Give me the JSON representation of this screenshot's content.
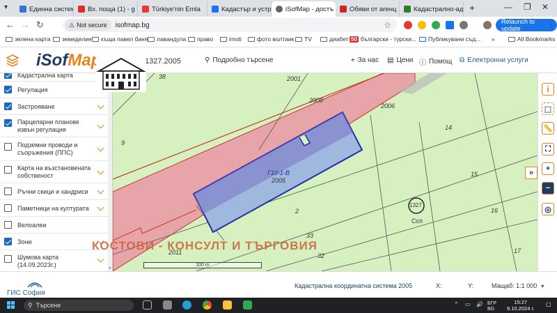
{
  "browser": {
    "tabs": [
      {
        "title": "Единна система"
      },
      {
        "title": "Вх. поща (1) - g"
      },
      {
        "title": "Türkiye'nin Emla"
      },
      {
        "title": "Кадастър и устр"
      },
      {
        "title": "iSofMap - достъ"
      },
      {
        "title": "Обяви от агенц"
      },
      {
        "title": "Кадастрално-ад"
      }
    ],
    "new_tab": "+",
    "address": {
      "security": "Not secure",
      "url": "isofmap.bg"
    },
    "relaunch_label": "Relaunch to update",
    "bookmarks": [
      {
        "label": "зелена карта"
      },
      {
        "label": "земеделие"
      },
      {
        "label": "къща павел баня"
      },
      {
        "label": "лавандула"
      },
      {
        "label": "право"
      },
      {
        "label": "imoti"
      },
      {
        "label": "фото волтаик"
      },
      {
        "label": "TV"
      },
      {
        "label": "диабет"
      },
      {
        "label": "български - турски..."
      },
      {
        "label": "Публикувани съд..."
      }
    ],
    "bookmark_badge": "50",
    "more_bookmarks": "»",
    "all_bookmarks": "All Bookmarks"
  },
  "app": {
    "logo_main": "iSof",
    "logo_accent": "Map",
    "search_value": "1327.2005",
    "advanced_search": "Подробно търсене",
    "nav": {
      "about": "За нас",
      "prices": "Цени",
      "help": "Помощ",
      "eservices": "Електронни услуги"
    }
  },
  "sidebar": {
    "items": [
      {
        "label": "Кадастрална карта",
        "checked": true
      },
      {
        "label": "Регулация",
        "checked": true
      },
      {
        "label": "Застрояване",
        "checked": true
      },
      {
        "label": "Парцеларни планове извън регулация",
        "checked": true
      },
      {
        "label": "Подземни проводи и съоръжения (ППС)",
        "checked": false
      },
      {
        "label": "Карта на възстановената собственост",
        "checked": false
      },
      {
        "label": "Ръчни скици и хандриси",
        "checked": false
      },
      {
        "label": "Паметници на културата",
        "checked": false
      },
      {
        "label": "Велоалеи",
        "checked": false
      },
      {
        "label": "Зони",
        "checked": true
      },
      {
        "label": "Шумова карта (14.09.2023г.)",
        "checked": false
      }
    ]
  },
  "map": {
    "labels": {
      "l38": "38",
      "l2001": "2001",
      "l2008": "2008",
      "l2006": "2006",
      "l14": "14",
      "l9": "9",
      "l10": "Г10-1-В",
      "l2005": "2005",
      "l15": "15",
      "l2": "2",
      "l16": "16",
      "l33": "33",
      "l32": "32",
      "l2011": "2011",
      "l17": "17",
      "circle": "1327",
      "csp": "Ссп"
    },
    "watermark": "КОСТОВИ - КОНСУЛТ И ТЪРГОВИЯ",
    "scale_bar": "100 m",
    "colors": {
      "background": "#d7f0bf",
      "regulation_band": "#e8a5a9",
      "selected_parcel": "#9fb8dd",
      "selected_outline": "#2a2aa5"
    }
  },
  "footer": {
    "gis_label": "ГИС София",
    "coord_system": "Кадастрална координатна система 2005",
    "x_label": "X:",
    "y_label": "Y:",
    "scale": "Мащаб: 1:1 000"
  },
  "taskbar": {
    "search_placeholder": "Търсене",
    "lang_top": "БГР",
    "lang_bottom": "BG",
    "time": "15:27",
    "date": "9.10.2024 г."
  }
}
